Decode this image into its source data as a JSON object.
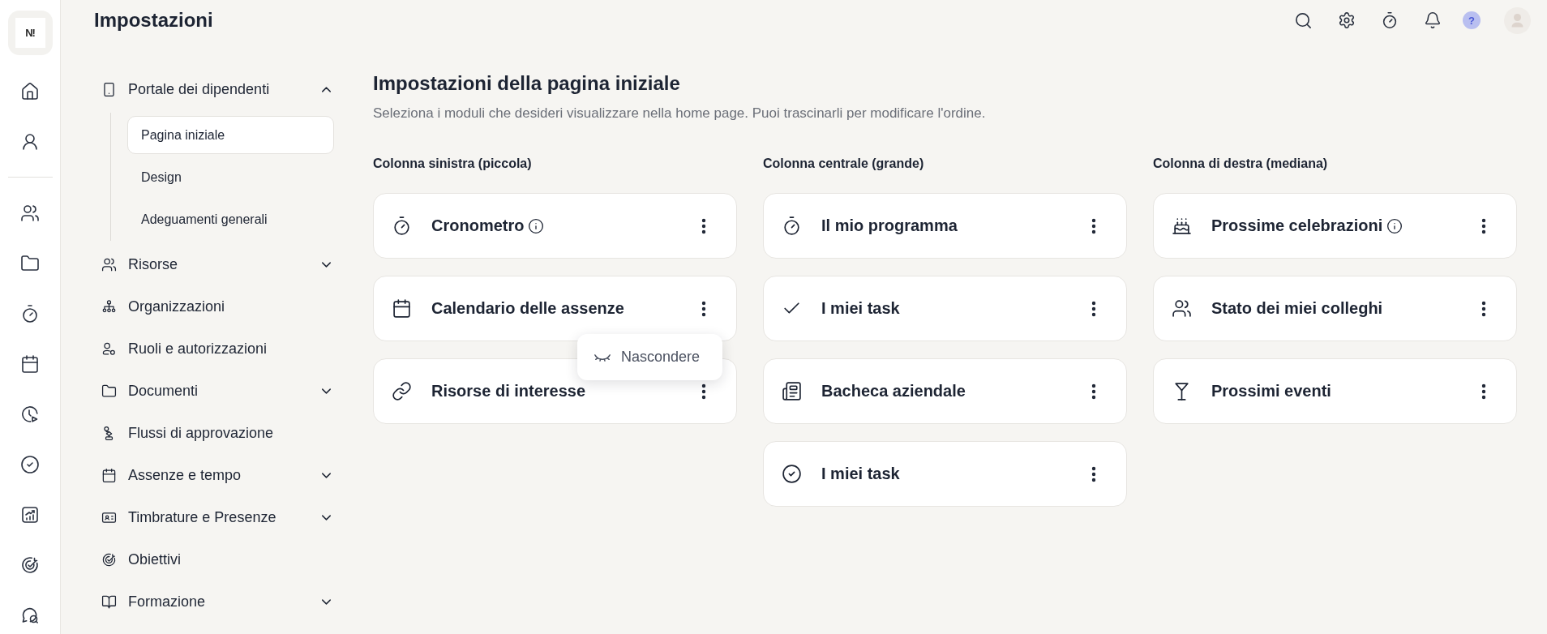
{
  "logo": {
    "text": "N!"
  },
  "header": {
    "title": "Impostazioni",
    "help_badge": "?"
  },
  "sidebar": {
    "items": [
      {
        "label": "Portale dei dipendenti",
        "kind": "group",
        "expanded": true,
        "children": [
          {
            "label": "Pagina iniziale",
            "selected": true
          },
          {
            "label": "Design",
            "selected": false
          },
          {
            "label": "Adeguamenti generali",
            "selected": false
          }
        ]
      },
      {
        "label": "Risorse",
        "kind": "group",
        "expanded": false
      },
      {
        "label": "Organizzazioni",
        "kind": "link"
      },
      {
        "label": "Ruoli e autorizzazioni",
        "kind": "link"
      },
      {
        "label": "Documenti",
        "kind": "group",
        "expanded": false
      },
      {
        "label": "Flussi di approvazione",
        "kind": "link"
      },
      {
        "label": "Assenze e tempo",
        "kind": "group",
        "expanded": false
      },
      {
        "label": "Timbrature e Presenze",
        "kind": "group",
        "expanded": false
      },
      {
        "label": "Obiettivi",
        "kind": "link"
      },
      {
        "label": "Formazione",
        "kind": "group",
        "expanded": false
      }
    ]
  },
  "page": {
    "title": "Impostazioni della pagina iniziale",
    "subtitle": "Seleziona i moduli che desideri visualizzare nella home page. Puoi trascinarli per modificare l'ordine."
  },
  "columns": [
    {
      "heading": "Colonna sinistra (piccola)",
      "cards": [
        {
          "title": "Cronometro",
          "info": true,
          "menu_open": false
        },
        {
          "title": "Calendario delle assenze",
          "info": false,
          "menu_open": true
        },
        {
          "title": "Risorse di interesse",
          "info": false,
          "menu_open": false
        }
      ]
    },
    {
      "heading": "Colonna centrale (grande)",
      "cards": [
        {
          "title": "Il mio programma",
          "info": false,
          "menu_open": false
        },
        {
          "title": "I miei task",
          "info": false,
          "menu_open": false
        },
        {
          "title": "Bacheca aziendale",
          "info": false,
          "menu_open": false
        },
        {
          "title": "I miei task",
          "info": false,
          "menu_open": false
        }
      ]
    },
    {
      "heading": "Colonna di destra (mediana)",
      "cards": [
        {
          "title": "Prossime celebrazioni",
          "info": true,
          "menu_open": false
        },
        {
          "title": "Stato dei miei colleghi",
          "info": false,
          "menu_open": false
        },
        {
          "title": "Prossimi eventi",
          "info": false,
          "menu_open": false
        }
      ]
    }
  ],
  "context_menu": {
    "items": [
      {
        "label": "Nascondere"
      }
    ]
  }
}
